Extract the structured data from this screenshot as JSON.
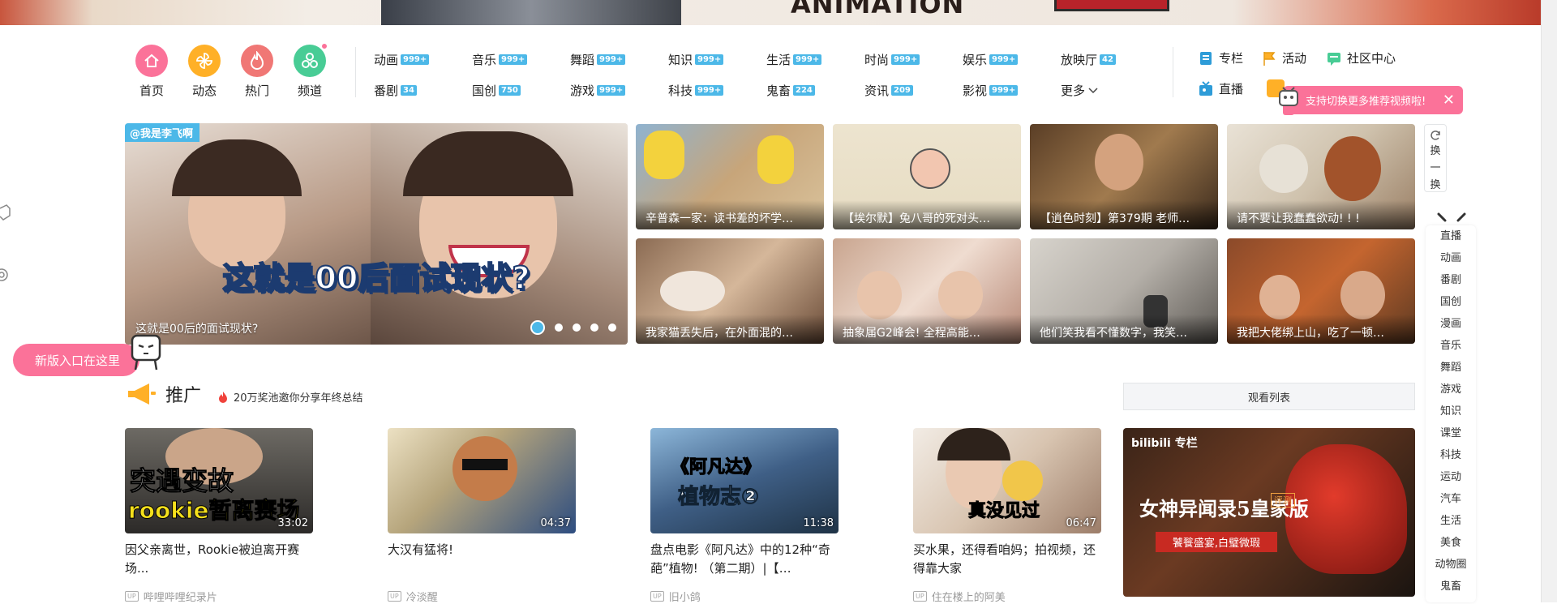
{
  "banner": {
    "headline": "ANIMATION"
  },
  "nav": {
    "main": [
      {
        "label": "首页",
        "icon": "home-icon",
        "color": "#fb7299"
      },
      {
        "label": "动态",
        "icon": "pinwheel-icon",
        "color": "#ffb027"
      },
      {
        "label": "热门",
        "icon": "flame-icon",
        "color": "#f07775"
      },
      {
        "label": "频道",
        "icon": "channel-icon",
        "color": "#48cc95"
      }
    ],
    "categories_row1": [
      {
        "label": "动画",
        "count": "999+"
      },
      {
        "label": "音乐",
        "count": "999+"
      },
      {
        "label": "舞蹈",
        "count": "999+"
      },
      {
        "label": "知识",
        "count": "999+"
      },
      {
        "label": "生活",
        "count": "999+"
      },
      {
        "label": "时尚",
        "count": "999+"
      },
      {
        "label": "娱乐",
        "count": "999+"
      },
      {
        "label": "放映厅",
        "count": "42"
      }
    ],
    "categories_row2": [
      {
        "label": "番剧",
        "count": "34"
      },
      {
        "label": "国创",
        "count": "750"
      },
      {
        "label": "游戏",
        "count": "999+"
      },
      {
        "label": "科技",
        "count": "999+"
      },
      {
        "label": "鬼畜",
        "count": "224"
      },
      {
        "label": "资讯",
        "count": "209"
      },
      {
        "label": "影视",
        "count": "999+"
      },
      {
        "label": "更多",
        "count": ""
      }
    ],
    "right_links": [
      "专栏",
      "活动",
      "社区中心",
      "直播"
    ]
  },
  "tip": {
    "text": "支持切换更多推荐视频啦!",
    "close": "✕"
  },
  "carousel": {
    "up_tag": "@我是李飞啊",
    "overlay_text": "这就是00后面试现状?",
    "caption": "这就是00后的面试现状?"
  },
  "feed_cards": [
    {
      "title": "辛普森一家：读书差的坏学…"
    },
    {
      "title": "【埃尔默】兔八哥的死对头…"
    },
    {
      "title": "【逍色时刻】第379期 老师…"
    },
    {
      "title": "请不要让我蠢蠢欲动! ! !"
    },
    {
      "title": "我家猫丢失后，在外面混的…"
    },
    {
      "title": "抽象届G2峰会! 全程高能…"
    },
    {
      "title": "他们笑我看不懂数字，我笑…"
    },
    {
      "title": "我把大佬绑上山，吃了一顿…"
    }
  ],
  "swap_button": {
    "chars": [
      "换",
      "一",
      "换"
    ]
  },
  "side_index": [
    "直播",
    "动画",
    "番剧",
    "国创",
    "漫画",
    "音乐",
    "舞蹈",
    "游戏",
    "知识",
    "课堂",
    "科技",
    "运动",
    "汽车",
    "生活",
    "美食",
    "动物圈",
    "鬼畜"
  ],
  "new_entry": {
    "label": "新版入口在这里"
  },
  "section": {
    "title": "推广",
    "hot_text": "20万奖池邀你分享年终总结",
    "watchlist": "观看列表"
  },
  "videos": [
    {
      "thumb_text": "突遇变故",
      "thumb_text2": "rookie暂离赛场",
      "duration": "33:02",
      "title": "因父亲离世，Rookie被迫离开赛场...",
      "up": "哔哩哔哩纪录片"
    },
    {
      "thumb_text": "",
      "thumb_text2": "",
      "duration": "04:37",
      "title": "大汉有猛将!",
      "up": "冷淡醒"
    },
    {
      "thumb_text": "《阿凡达》",
      "thumb_text2": "植物志②",
      "duration": "11:38",
      "title": "盘点电影《阿凡达》中的12种“奇葩”植物! （第二期）|【…",
      "up": "旧小鸽"
    },
    {
      "thumb_text": "真没见过",
      "thumb_text2": "",
      "duration": "06:47",
      "title": "买水果，还得看咱妈；拍视频，还得靠大家",
      "up": "住在楼上的阿美"
    }
  ],
  "ad": {
    "logo": "bilibili 专栏",
    "game_title": "女神异闻录5皇家版",
    "slogan": "饕餮盛宴,白璧微瑕",
    "badge": "评测"
  }
}
